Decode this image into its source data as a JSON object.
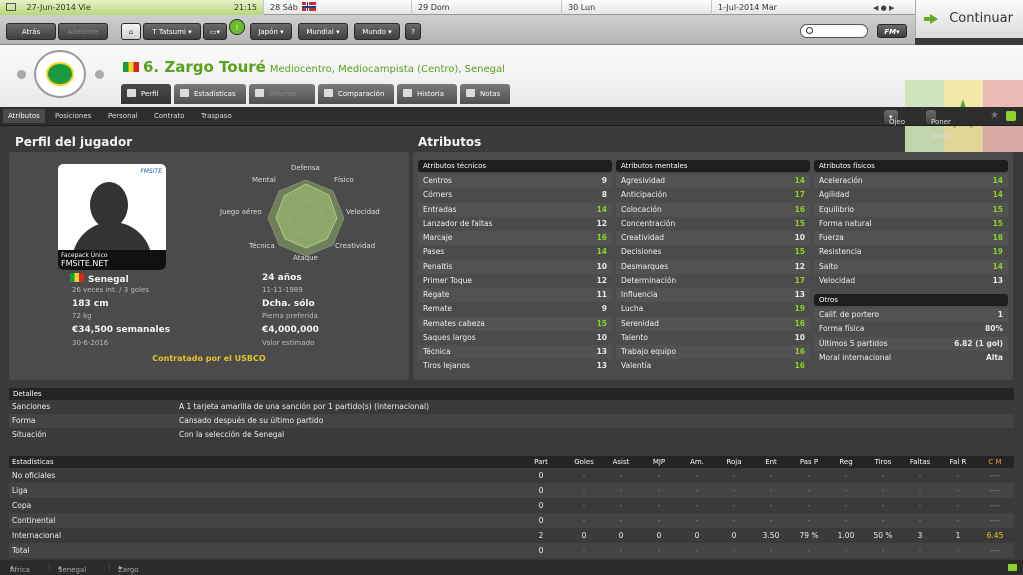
{
  "calendar": {
    "current_date": "27-Jun-2014 Vie",
    "time": "21:15",
    "days": [
      "28 Sáb",
      "29 Dom",
      "30 Lun",
      "1-Jul-2014 Mar"
    ]
  },
  "continue_label": "Continuar",
  "toolbar": {
    "back": "Atrás",
    "forward": "Adelante",
    "manager": "T Tatsumi",
    "japan": "Japón",
    "world_cup": "Mundial",
    "world": "Mundo",
    "help": "?",
    "fm": "FM"
  },
  "player": {
    "number_name": "6. Zargo Touré",
    "position": "Mediocentro, Mediocampista (Centro), Senegal",
    "tabs": [
      "Perfil",
      "Estadísticas",
      "Informe",
      "Comparación",
      "Historia",
      "Notas"
    ]
  },
  "subnav": {
    "items": [
      "Atributos",
      "Posiciones",
      "Personal",
      "Contrato",
      "Traspaso"
    ],
    "scout": "Ojeo",
    "nickname": "Poner apodo"
  },
  "profile": {
    "title": "Perfil del jugador",
    "photo_label1": "Facepack Único",
    "photo_label2": "FMSITE.NET",
    "photo_logo": "FMSITE",
    "radar_labels": [
      "Defensa",
      "Físico",
      "Velocidad",
      "Creatividad",
      "Ataque",
      "Técnica",
      "Juego aéreo",
      "Mental"
    ],
    "nation": "Senegal",
    "caps": "26 veces int. / 3 goles",
    "age": "24 años",
    "dob": "11-11-1989",
    "height": "183 cm",
    "weight": "72 kg",
    "foot": "Dcha. sólo",
    "foot_label": "Pierna preferida",
    "wage": "€34,500 semanales",
    "contract_end": "30-6-2016",
    "value": "€4,000,000",
    "value_label": "Valor estimado",
    "contract_by": "Contratado por el USBCO"
  },
  "attributes": {
    "title": "Atributos",
    "technical_title": "Atributos técnicos",
    "technical": [
      [
        "Centros",
        "9"
      ],
      [
        "Córners",
        "8"
      ],
      [
        "Entradas",
        "14"
      ],
      [
        "Lanzador de faltas",
        "12"
      ],
      [
        "Marcaje",
        "16"
      ],
      [
        "Pases",
        "14"
      ],
      [
        "Penaltis",
        "10"
      ],
      [
        "Primer Toque",
        "12"
      ],
      [
        "Regate",
        "11"
      ],
      [
        "Remate",
        "9"
      ],
      [
        "Remates cabeza",
        "15"
      ],
      [
        "Saques largos",
        "10"
      ],
      [
        "Técnica",
        "13"
      ],
      [
        "Tiros lejanos",
        "13"
      ]
    ],
    "mental_title": "Atributos mentales",
    "mental": [
      [
        "Agresividad",
        "14"
      ],
      [
        "Anticipación",
        "17"
      ],
      [
        "Colocación",
        "16"
      ],
      [
        "Concentración",
        "15"
      ],
      [
        "Creatividad",
        "10"
      ],
      [
        "Decisiones",
        "15"
      ],
      [
        "Desmarques",
        "12"
      ],
      [
        "Determinación",
        "17"
      ],
      [
        "Influencia",
        "13"
      ],
      [
        "Lucha",
        "19"
      ],
      [
        "Serenidad",
        "16"
      ],
      [
        "Talento",
        "10"
      ],
      [
        "Trabajo equipo",
        "16"
      ],
      [
        "Valentía",
        "16"
      ]
    ],
    "physical_title": "Atributos físicos",
    "physical": [
      [
        "Aceleración",
        "14"
      ],
      [
        "Agilidad",
        "14"
      ],
      [
        "Equilibrio",
        "15"
      ],
      [
        "Forma natural",
        "15"
      ],
      [
        "Fuerza",
        "18"
      ],
      [
        "Resistencia",
        "19"
      ],
      [
        "Salto",
        "14"
      ],
      [
        "Velocidad",
        "13"
      ]
    ],
    "other_title": "Otros",
    "other": [
      [
        "Calif. de portero",
        "1"
      ],
      [
        "Forma física",
        "80%"
      ],
      [
        "Últimos 5 partidos",
        "6.82 (1 gol)"
      ],
      [
        "Moral internacional",
        "Alta"
      ]
    ]
  },
  "details": {
    "title": "Detalles",
    "rows": [
      [
        "Sanciones",
        "A 1 tarjeta amarilla de una sanción por 1 partido(s) (Internacional)"
      ],
      [
        "Forma",
        "Cansado después de su último partido"
      ],
      [
        "Situación",
        "Con la selección de Senegal"
      ]
    ]
  },
  "stats": {
    "title": "Estadísticas",
    "columns": [
      "Part",
      "Goles",
      "Asist",
      "MJP",
      "Am.",
      "Roja",
      "Ent",
      "Pas P",
      "Reg",
      "Tiros",
      "Faltas",
      "Fal R",
      "C M"
    ],
    "rows": [
      {
        "label": "No oficiales",
        "values": [
          "0",
          "-",
          "-",
          "-",
          "-",
          "-",
          "-",
          "-",
          "-",
          "-",
          "-",
          "-",
          "----"
        ]
      },
      {
        "label": "Liga",
        "values": [
          "0",
          "-",
          "-",
          "-",
          "-",
          "-",
          "-",
          "-",
          "-",
          "-",
          "-",
          "-",
          "----"
        ]
      },
      {
        "label": "Copa",
        "values": [
          "0",
          "-",
          "-",
          "-",
          "-",
          "-",
          "-",
          "-",
          "-",
          "-",
          "-",
          "-",
          "----"
        ]
      },
      {
        "label": "Continental",
        "values": [
          "0",
          "-",
          "-",
          "-",
          "-",
          "-",
          "-",
          "-",
          "-",
          "-",
          "-",
          "-",
          "----"
        ]
      },
      {
        "label": "Internacional",
        "values": [
          "2",
          "0",
          "0",
          "0",
          "0",
          "0",
          "3.50",
          "79 %",
          "1.00",
          "50 %",
          "3",
          "1",
          "6.45"
        ]
      },
      {
        "label": "Total",
        "values": [
          "0",
          "-",
          "-",
          "-",
          "-",
          "-",
          "-",
          "-",
          "-",
          "-",
          "-",
          "-",
          "----"
        ]
      }
    ]
  },
  "footer": {
    "crumbs": [
      "África",
      "Senegal",
      "Zargo Touré"
    ]
  },
  "colors": {
    "accent_green": "#8ed12a",
    "name_green": "#5aa11d",
    "contract_yellow": "#e4c32e",
    "rating_orange": "#e8a33a"
  }
}
